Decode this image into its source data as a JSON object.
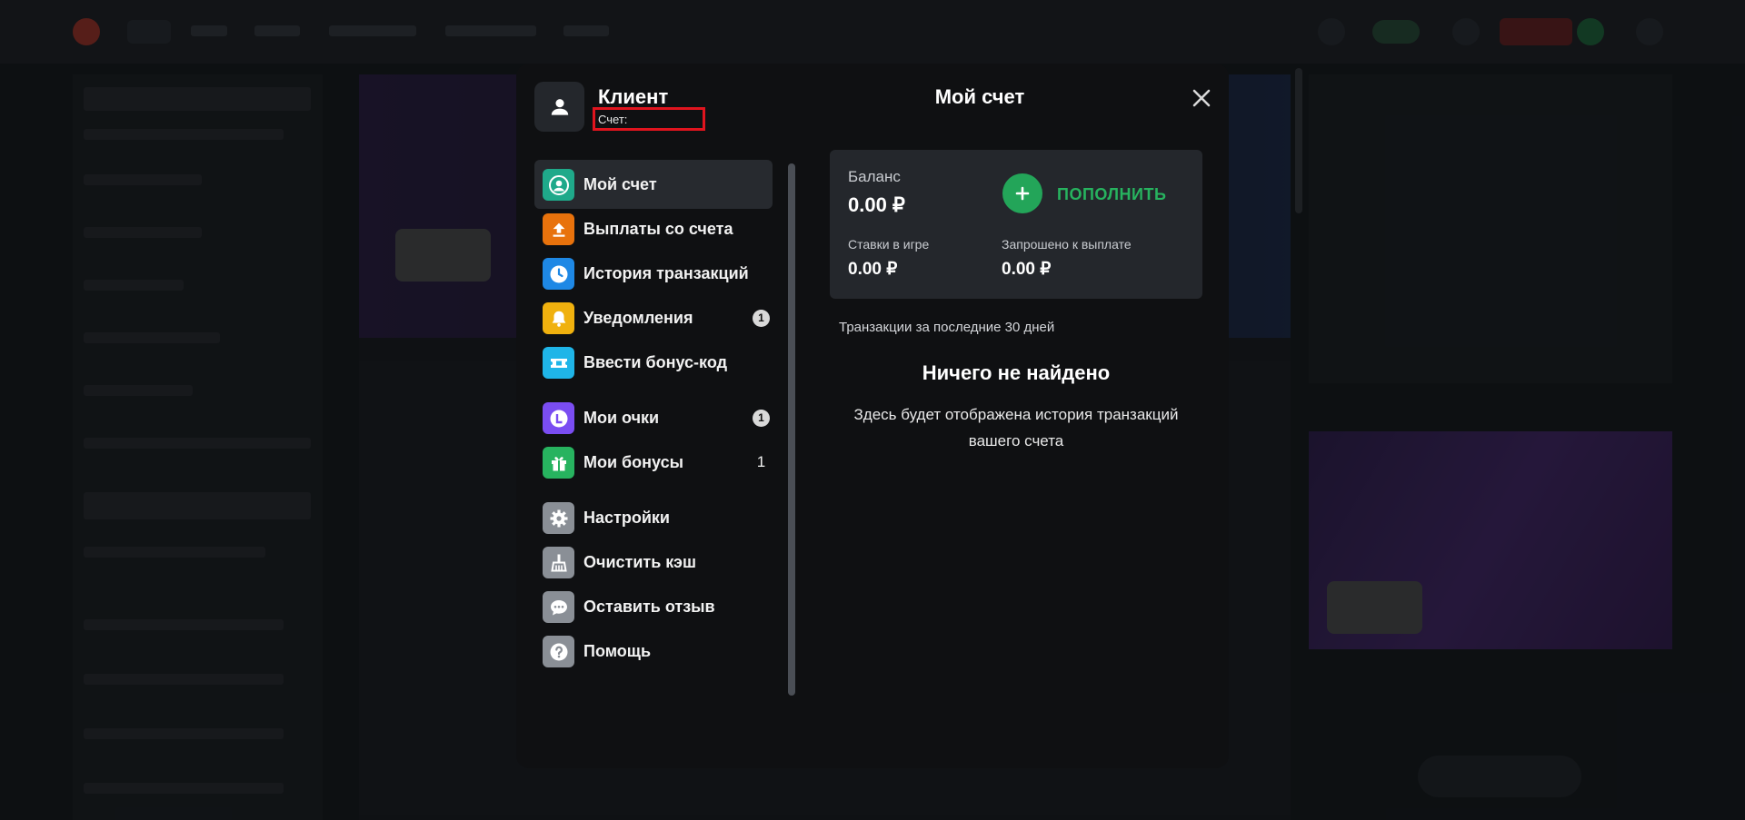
{
  "modal": {
    "client_name": "Клиент",
    "account_label": "Счет:",
    "title": "Мой счет",
    "menu": [
      {
        "label": "Мой счет",
        "icon": "user-circle-icon",
        "color": "#1fa98a",
        "active": true
      },
      {
        "label": "Выплаты со счета",
        "icon": "upload-icon",
        "color": "#e8720c"
      },
      {
        "label": "История транзакций",
        "icon": "clock-icon",
        "color": "#1e88e5"
      },
      {
        "label": "Уведомления",
        "icon": "bell-icon",
        "color": "#f0b10e",
        "badge": "1"
      },
      {
        "label": "Ввести бонус-код",
        "icon": "ticket-icon",
        "color": "#1fb5e8"
      },
      {
        "label": "Мои очки",
        "icon": "points-icon",
        "color": "#7a4df2",
        "badge": "1"
      },
      {
        "label": "Мои бонусы",
        "icon": "gift-icon",
        "color": "#27b35f",
        "count": "1"
      },
      {
        "label": "Настройки",
        "icon": "gear-icon",
        "color": "#8a8f96"
      },
      {
        "label": "Очистить кэш",
        "icon": "broom-icon",
        "color": "#8a8f96"
      },
      {
        "label": "Оставить отзыв",
        "icon": "chat-icon",
        "color": "#8a8f96"
      },
      {
        "label": "Помощь",
        "icon": "help-icon",
        "color": "#8a8f96"
      }
    ],
    "balance": {
      "label": "Баланс",
      "value": "0.00 ₽",
      "deposit_label": "ПОПОЛНИТЬ",
      "bets_label": "Ставки в игре",
      "bets_value": "0.00 ₽",
      "withdraw_label": "Запрошено к выплате",
      "withdraw_value": "0.00 ₽"
    },
    "transactions_period": "Транзакции за последние 30 дней",
    "empty_title": "Ничего не найдено",
    "empty_text": "Здесь будет отображена история транзакций вашего счета"
  },
  "colors": {
    "accent_green": "#23a559",
    "modal_bg": "#0f1012",
    "highlight_red": "#e0141e"
  }
}
